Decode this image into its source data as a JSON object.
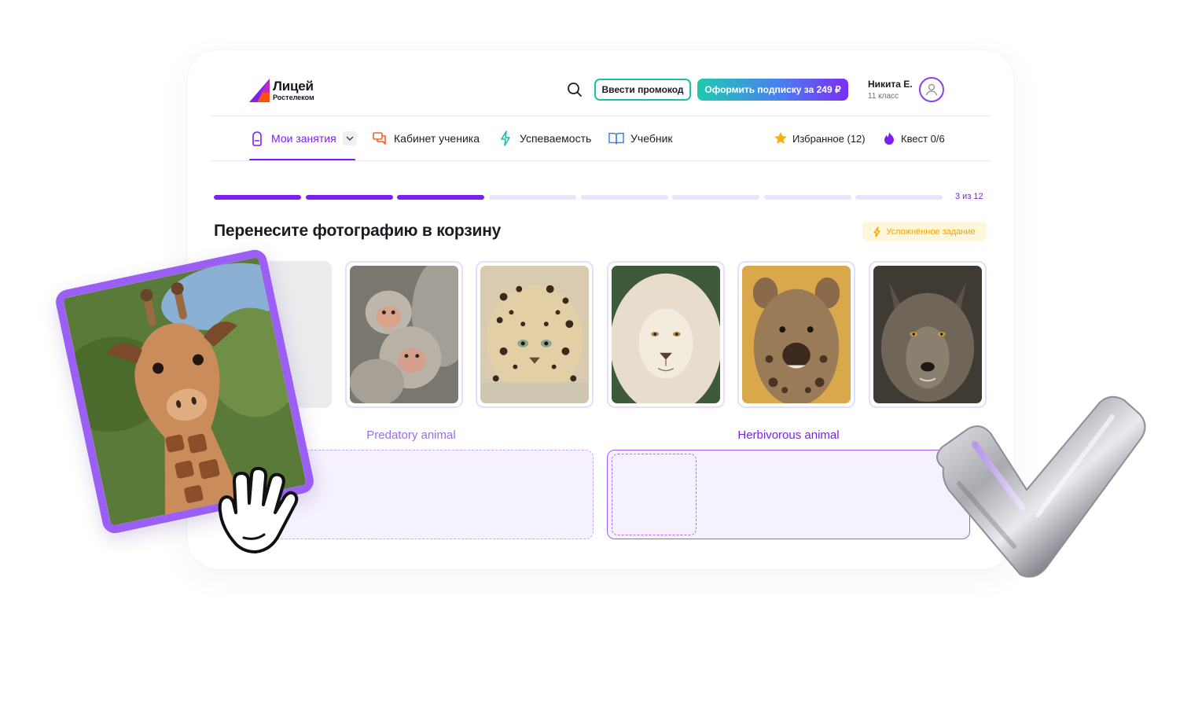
{
  "brand": {
    "name": "Лицей",
    "sub": "Ростелеком"
  },
  "header": {
    "promo_label": "Ввести промокод",
    "subscribe_label": "Оформить подписку за 249 ₽",
    "user_name": "Никита Е.",
    "user_grade": "11 класс"
  },
  "nav": {
    "items": [
      {
        "label": "Мои занятия",
        "icon": "backpack-icon",
        "active": true
      },
      {
        "label": "Кабинет ученика",
        "icon": "chat-icon"
      },
      {
        "label": "Успеваемость",
        "icon": "lightning-icon"
      },
      {
        "label": "Учебник",
        "icon": "book-icon"
      }
    ],
    "favorites_label": "Избранное (12)",
    "quest_label": "Квест 0/6"
  },
  "progress": {
    "current": 3,
    "total": 12,
    "label": "3 из 12"
  },
  "task": {
    "title": "Перенесите фотографию в корзину",
    "difficulty_badge": "Усложнённое задание",
    "photos": [
      "monkeys",
      "leopard",
      "lion",
      "hyena",
      "wolf"
    ],
    "dragged_photo": "giraffe"
  },
  "baskets": {
    "left_label": "Predatory animal",
    "right_label": "Herbivorous animal"
  },
  "colors": {
    "accent": "#7d1ff0",
    "teal": "#1dbfa8",
    "badge_text": "#f2a200",
    "basket_bg": "#f6f1fe"
  }
}
